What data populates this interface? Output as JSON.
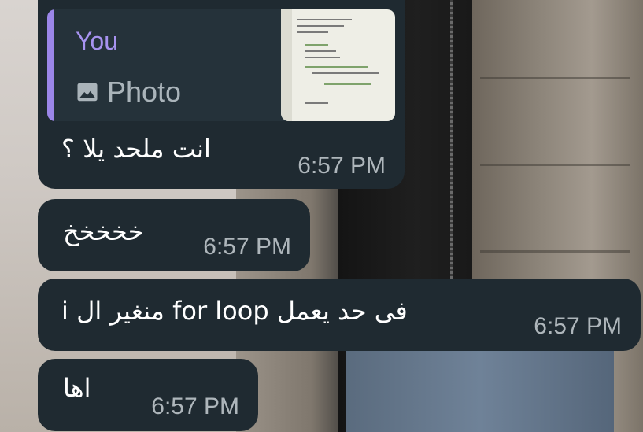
{
  "messages": [
    {
      "reply": {
        "name": "You",
        "type": "Photo",
        "icon": "photo-icon"
      },
      "text": "انت ملحد يلا ؟",
      "time": "6:57 PM"
    },
    {
      "text": "خخخخخ",
      "time": "6:57 PM"
    },
    {
      "text": "فى حد يعمل for loop منغير ال i",
      "time": "6:57 PM"
    },
    {
      "text": "اها",
      "time": "6:57 PM"
    }
  ],
  "colors": {
    "bubble": "#1f2a31",
    "reply_accent": "#9b86e8",
    "reply_name": "#a793f0",
    "time": "#aeb6bb"
  }
}
